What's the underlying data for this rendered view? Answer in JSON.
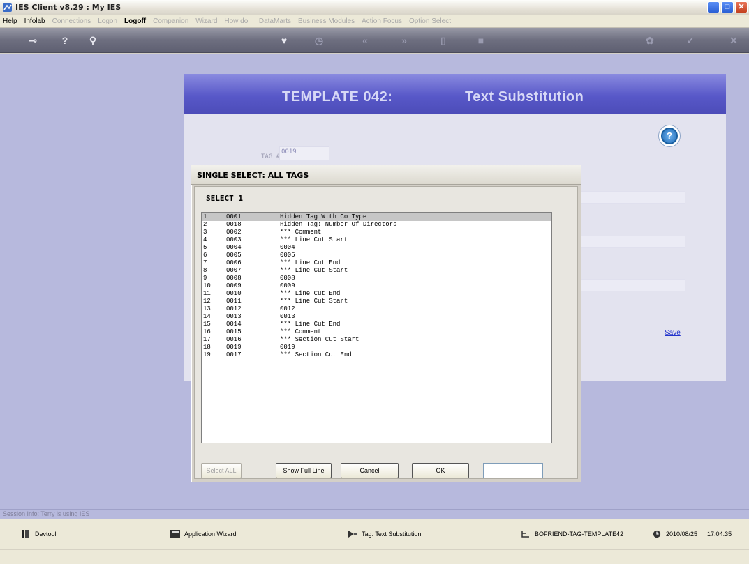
{
  "window": {
    "title": "IES Client v8.29 : My IES",
    "min": "_",
    "max": "□",
    "close": "✕"
  },
  "menu": [
    {
      "label": "Help",
      "enabled": true,
      "bold": false
    },
    {
      "label": "Infolab",
      "enabled": true,
      "bold": false
    },
    {
      "label": "Connections",
      "enabled": false
    },
    {
      "label": "Logon",
      "enabled": false
    },
    {
      "label": "Logoff",
      "enabled": true,
      "bold": true
    },
    {
      "label": "Companion",
      "enabled": false
    },
    {
      "label": "Wizard",
      "enabled": false
    },
    {
      "label": "How do I",
      "enabled": false
    },
    {
      "label": "DataMarts",
      "enabled": false
    },
    {
      "label": "Business Modules",
      "enabled": false
    },
    {
      "label": "Action Focus",
      "enabled": false
    },
    {
      "label": "Option Select",
      "enabled": false
    }
  ],
  "toolbar": {
    "key": "⊸",
    "help": "?",
    "search": "⚲",
    "heart": "♥",
    "clock": "◷",
    "prev": "«",
    "next": "»",
    "doc": "▯",
    "stop": "■",
    "settings": "✿",
    "check": "✓",
    "close": "✕"
  },
  "template": {
    "title_left": "TEMPLATE 042:",
    "title_right": "Text Substitution",
    "help": "?",
    "tag_label": "TAG #",
    "tag_value": "0019",
    "save": "Save"
  },
  "dialog": {
    "title": "SINGLE SELECT: ALL TAGS",
    "select_label": "SELECT 1",
    "rows": [
      {
        "n": "1",
        "code": "0001",
        "desc": "Hidden Tag With Co Type"
      },
      {
        "n": "2",
        "code": "0018",
        "desc": "Hidden Tag: Number Of Directors"
      },
      {
        "n": "3",
        "code": "0002",
        "desc": "*** Comment"
      },
      {
        "n": "4",
        "code": "0003",
        "desc": "*** Line Cut Start"
      },
      {
        "n": "5",
        "code": "0004",
        "desc": "0004"
      },
      {
        "n": "6",
        "code": "0005",
        "desc": "0005"
      },
      {
        "n": "7",
        "code": "0006",
        "desc": "*** Line Cut End"
      },
      {
        "n": "8",
        "code": "0007",
        "desc": "*** Line Cut Start"
      },
      {
        "n": "9",
        "code": "0008",
        "desc": "0008"
      },
      {
        "n": "10",
        "code": "0009",
        "desc": "0009"
      },
      {
        "n": "11",
        "code": "0010",
        "desc": "*** Line Cut End"
      },
      {
        "n": "12",
        "code": "0011",
        "desc": "*** Line Cut Start"
      },
      {
        "n": "13",
        "code": "0012",
        "desc": "0012"
      },
      {
        "n": "14",
        "code": "0013",
        "desc": "0013"
      },
      {
        "n": "15",
        "code": "0014",
        "desc": "*** Line Cut End"
      },
      {
        "n": "16",
        "code": "0015",
        "desc": "*** Comment"
      },
      {
        "n": "17",
        "code": "0016",
        "desc": "*** Section Cut Start"
      },
      {
        "n": "18",
        "code": "0019",
        "desc": "0019"
      },
      {
        "n": "19",
        "code": "0017",
        "desc": "*** Section Cut End"
      }
    ],
    "buttons": {
      "select_all": "Select ALL",
      "show_full_line": "Show Full Line",
      "cancel": "Cancel",
      "ok": "OK"
    }
  },
  "session_info": "Session Info: Terry is using IES",
  "statusbar": {
    "devtool": "Devtool",
    "app_wizard": "Application Wizard",
    "tag": "Tag: Text Substitution",
    "file": "BOFRIEND-TAG-TEMPLATE42",
    "date": "2010/08/25",
    "time": "17:04:35"
  },
  "colors": {
    "toolbar": "#6e6f80",
    "workspace": "#b7b9dd",
    "header": "#5858c8",
    "selected_row": "#c6c6c6"
  }
}
